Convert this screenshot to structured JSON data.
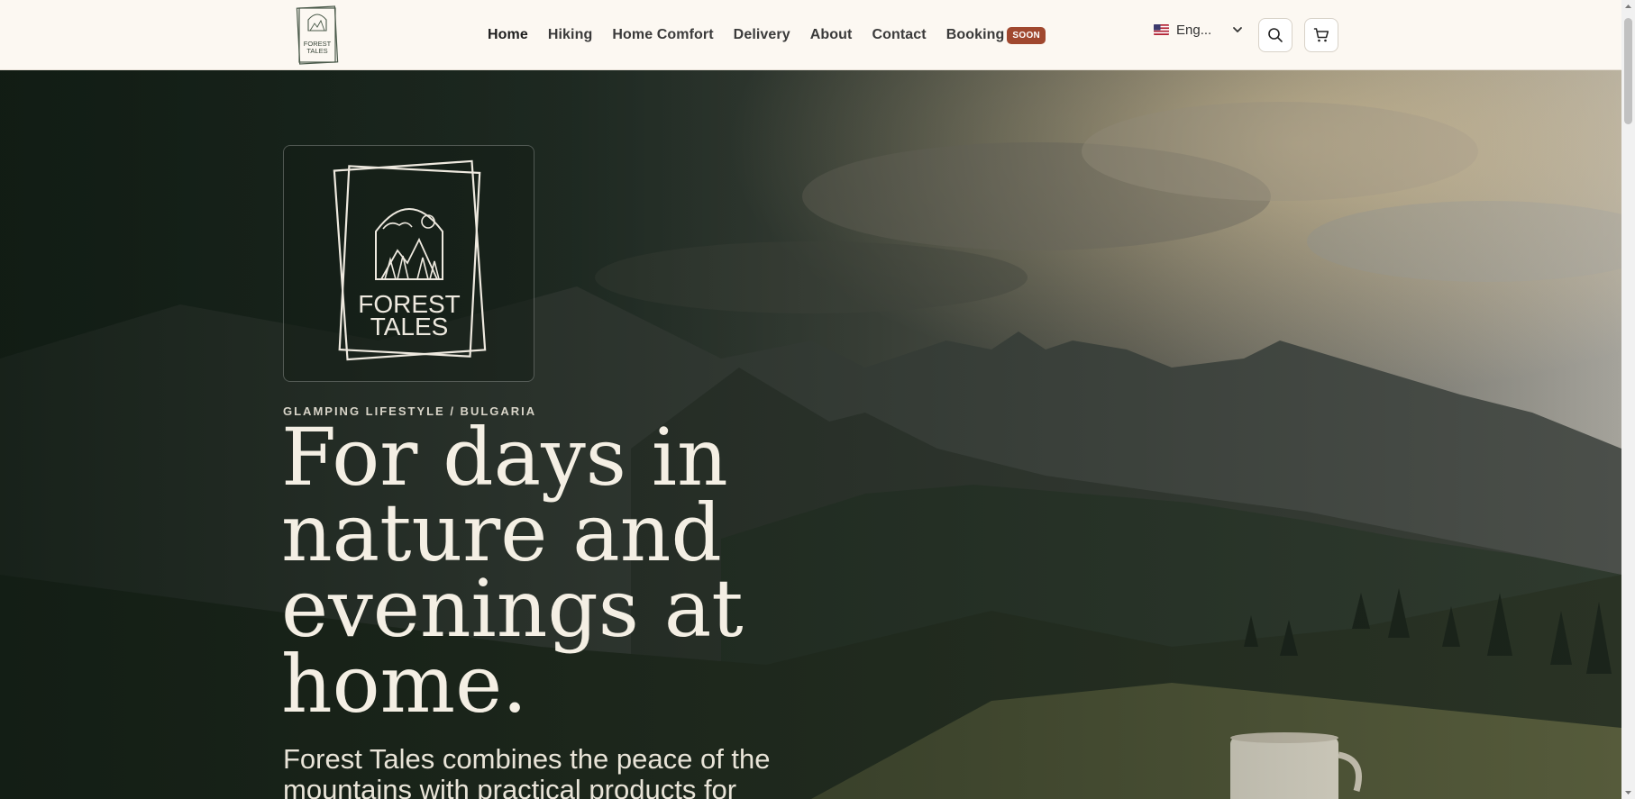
{
  "header": {
    "logo_text_line1": "FOREST",
    "logo_text_line2": "TALES",
    "nav": {
      "home": "Home",
      "hiking": "Hiking",
      "home_comfort": "Home Comfort",
      "delivery": "Delivery",
      "about": "About",
      "contact": "Contact",
      "booking": "Booking",
      "booking_badge": "SOON"
    },
    "language": "Eng..."
  },
  "hero": {
    "logo_line1": "FOREST",
    "logo_line2": "TALES",
    "kicker": "GLAMPING LIFESTYLE / BULGARIA",
    "headline": "For days in nature and evenings at home.",
    "lead": "Forest Tales combines the peace of the mountains with practical products for biking"
  },
  "colors": {
    "accent": "#a0482f",
    "header_bg": "#fcf8f2",
    "hero_text": "#f4efe4"
  }
}
